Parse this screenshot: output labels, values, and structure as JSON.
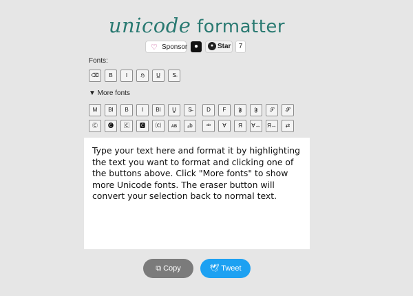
{
  "logo": {
    "word1": "unicode",
    "word2": "formatter"
  },
  "topbar": {
    "sponsor_label": "Sponsor",
    "sponsor_icon": "heart-icon",
    "github_icon": "github-icon",
    "star_label": "Star",
    "star_count": "7"
  },
  "fonts_label": "Fonts:",
  "basic_buttons": [
    "⌫",
    "B",
    "I",
    "ℌ",
    "U̲",
    "S̶"
  ],
  "more_fonts_label": "▼ More fonts",
  "more_row1": [
    "M",
    "BI",
    "B",
    "I",
    "BI",
    "U̳",
    "S̶",
    "D",
    "F",
    "𝕱",
    "𝕱",
    "𝒮",
    "𝓢"
  ],
  "more_row2": [
    "Ⓒ",
    "🅒",
    "🄲",
    "🅲",
    "⒞",
    "ᴀʙ",
    "ₐb",
    "ᵃᵇ",
    "∀",
    "Я",
    "∀↔",
    "Я↔",
    "⇄"
  ],
  "editor_text": "Type your text here and format it by highlighting the text you want to format and clicking one of the buttons above. Click \"More fonts\" to show more Unicode fonts. The eraser button will convert your selection back to normal text.",
  "copy_label": "Copy",
  "copy_icon": "copy-icon",
  "tweet_label": "Tweet",
  "tweet_icon": "bird-icon"
}
